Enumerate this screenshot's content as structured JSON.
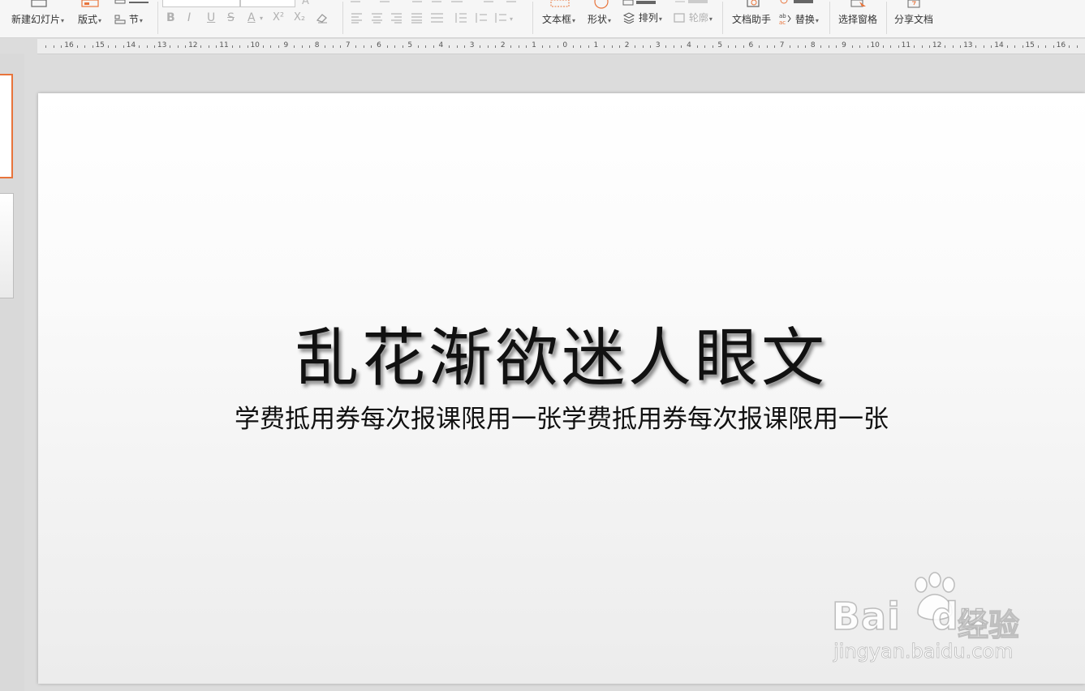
{
  "ribbon": {
    "new_slide": "新建幻灯片",
    "layout": "版式",
    "section": "节",
    "text_box": "文本框",
    "shape": "形状",
    "arrange": "排列",
    "outline": "轮廓",
    "doc_helper": "文档助手",
    "replace": "替换",
    "selection_pane": "选择窗格",
    "share_doc": "分享文档",
    "format_buttons": [
      "B",
      "I",
      "U",
      "S",
      "A",
      "X²",
      "X₂"
    ]
  },
  "ruler": {
    "ticks": [
      "16",
      "15",
      "14",
      "13",
      "12",
      "11",
      "10",
      "9",
      "8",
      "7",
      "6",
      "5",
      "4",
      "3",
      "2",
      "1",
      "0",
      "1",
      "2",
      "3",
      "4",
      "5",
      "6",
      "7",
      "8",
      "9",
      "10",
      "11",
      "12",
      "13",
      "14",
      "15",
      "16"
    ]
  },
  "slide": {
    "title": "乱花渐欲迷人眼文",
    "subtitle": "学费抵用券每次报课限用一张学费抵用券每次报课限用一张"
  },
  "watermark": {
    "brand": "Bai",
    "brand_end": "du",
    "brand_cn": "经验",
    "url": "jingyan.baidu.com"
  },
  "colors": {
    "accent": "#e8743b",
    "ribbon_bg": "#f6f6f6",
    "workspace_bg": "#dcdcdc"
  }
}
